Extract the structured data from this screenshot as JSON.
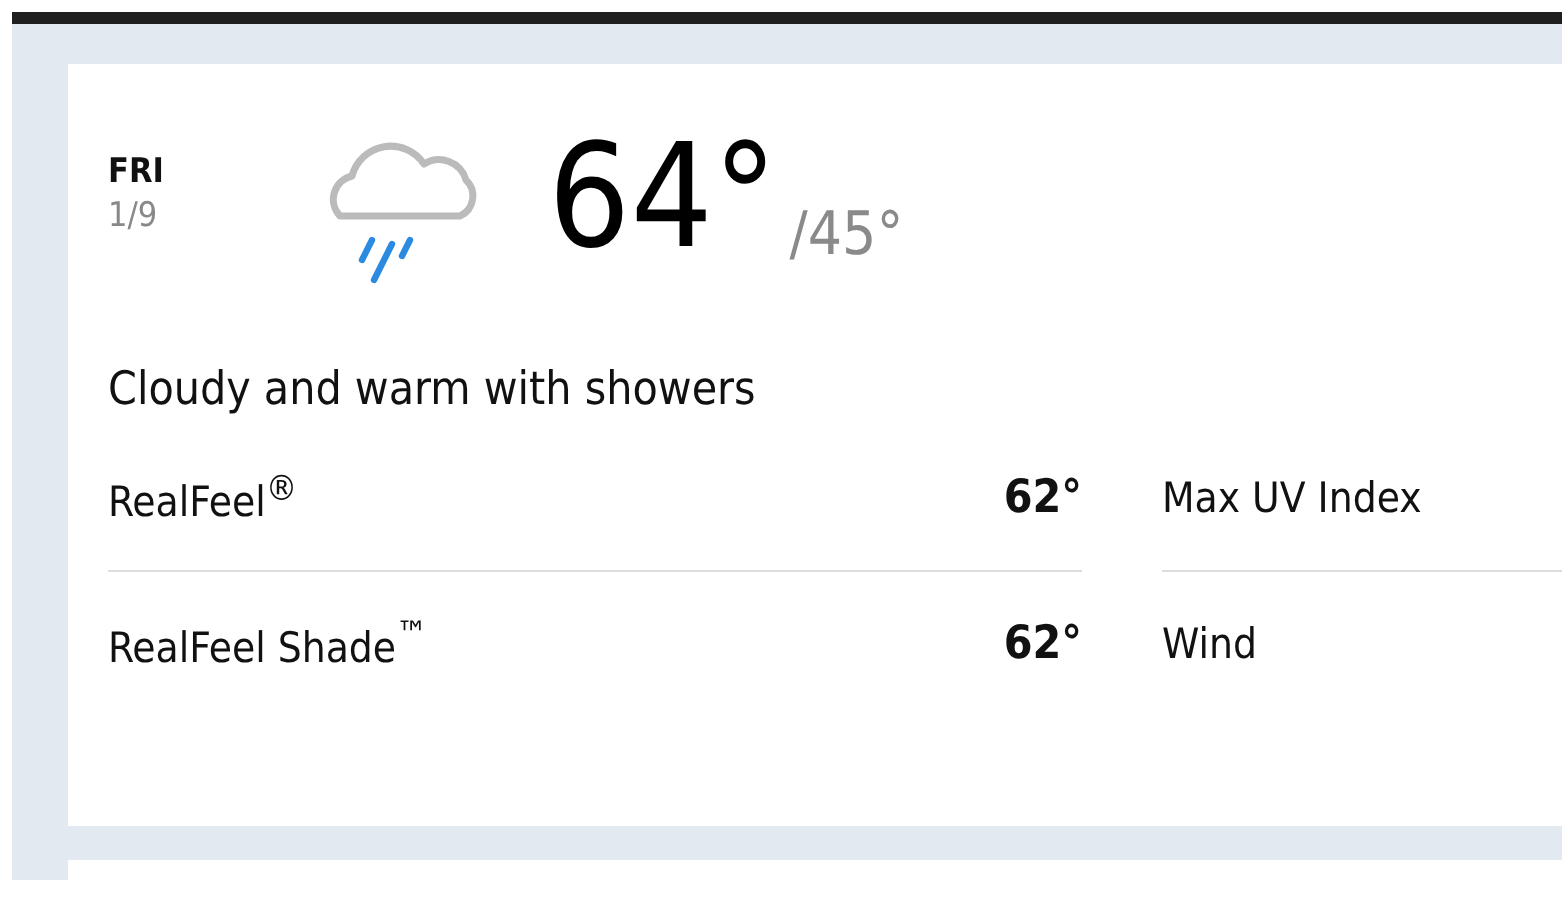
{
  "day": {
    "weekday": "FRI",
    "date": "1/9"
  },
  "temperature": {
    "high": "64°",
    "low": "/45°"
  },
  "phrase": "Cloudy and warm with showers",
  "details_left": [
    {
      "label": "RealFeel$^{®}$",
      "value": "62°"
    },
    {
      "label": "RealFeel Shade$^{™}$",
      "value": "62°"
    }
  ],
  "details_right": [
    {
      "label": "Max UV Index"
    },
    {
      "label": "Wind"
    }
  ]
}
